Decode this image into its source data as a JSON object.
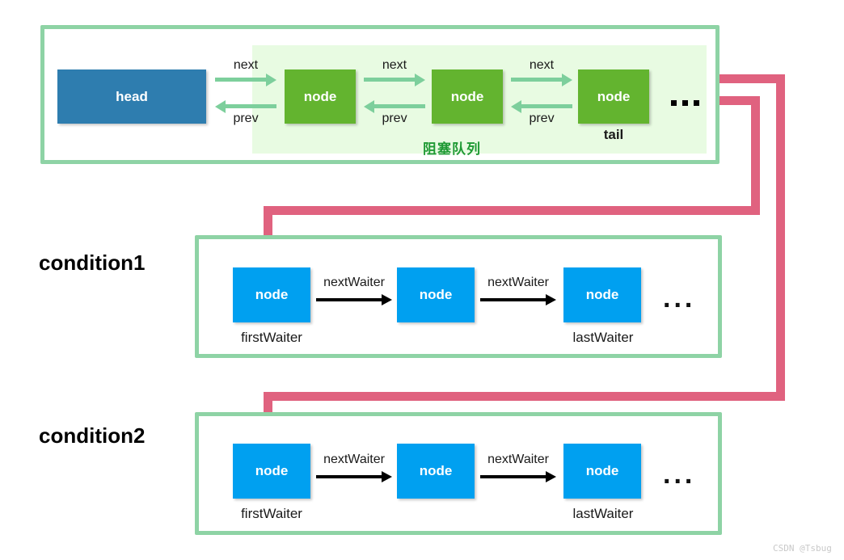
{
  "diagram": {
    "title_watermark": "CSDN @Tsbug",
    "colors": {
      "frame_green": "#8ed3a5",
      "panel_light_green": "#e8fbe2",
      "head_blue": "#2e7daf",
      "node_green": "#63b42f",
      "node_blue": "#00a0f0",
      "arrow_green": "#7dcf9c",
      "pink_link": "#e0627f",
      "label_green": "#1f9a34"
    }
  },
  "queue_panel": {
    "region_label": "阻塞队列",
    "head_box": {
      "label": "head"
    },
    "nodes": [
      {
        "label": "node",
        "caption": ""
      },
      {
        "label": "node",
        "caption": ""
      },
      {
        "label": "node",
        "caption": "tail"
      }
    ],
    "links": [
      {
        "forward": "next",
        "backward": "prev"
      },
      {
        "forward": "next",
        "backward": "prev"
      },
      {
        "forward": "next",
        "backward": "prev"
      }
    ],
    "overflow_dots": "..."
  },
  "conditions": [
    {
      "title": "condition1",
      "nodes": [
        {
          "label": "node",
          "caption": "firstWaiter"
        },
        {
          "label": "node",
          "caption": ""
        },
        {
          "label": "node",
          "caption": "lastWaiter"
        }
      ],
      "links": [
        {
          "label": "nextWaiter"
        },
        {
          "label": "nextWaiter"
        }
      ],
      "overflow_dots": "..."
    },
    {
      "title": "condition2",
      "nodes": [
        {
          "label": "node",
          "caption": "firstWaiter"
        },
        {
          "label": "node",
          "caption": ""
        },
        {
          "label": "node",
          "caption": "lastWaiter"
        }
      ],
      "links": [
        {
          "label": "nextWaiter"
        },
        {
          "label": "nextWaiter"
        }
      ],
      "overflow_dots": "..."
    }
  ]
}
